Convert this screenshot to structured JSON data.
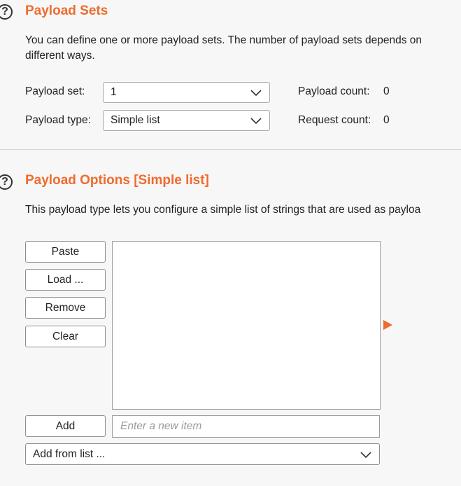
{
  "payload_sets": {
    "title": "Payload Sets",
    "description_line1": "You can define one or more payload sets. The number of payload sets depends on",
    "description_line2": "different ways.",
    "payload_set_label": "Payload set:",
    "payload_set_value": "1",
    "payload_type_label": "Payload type:",
    "payload_type_value": "Simple list",
    "payload_count_label": "Payload count:",
    "payload_count_value": "0",
    "request_count_label": "Request count:",
    "request_count_value": "0"
  },
  "payload_options": {
    "title": "Payload Options [Simple list]",
    "description": "This payload type lets you configure a simple list of strings that are used as payloa",
    "buttons": {
      "paste": "Paste",
      "load": "Load ...",
      "remove": "Remove",
      "clear": "Clear",
      "add": "Add"
    },
    "list_items": [],
    "new_item_placeholder": "Enter a new item",
    "add_from_list_value": "Add from list ..."
  },
  "icons": {
    "help": "help-icon",
    "dropdown": "chevron-down-icon",
    "expand": "triangle-right-icon"
  },
  "colors": {
    "accent": "#ef6b2e",
    "background": "#f7f7f7"
  }
}
